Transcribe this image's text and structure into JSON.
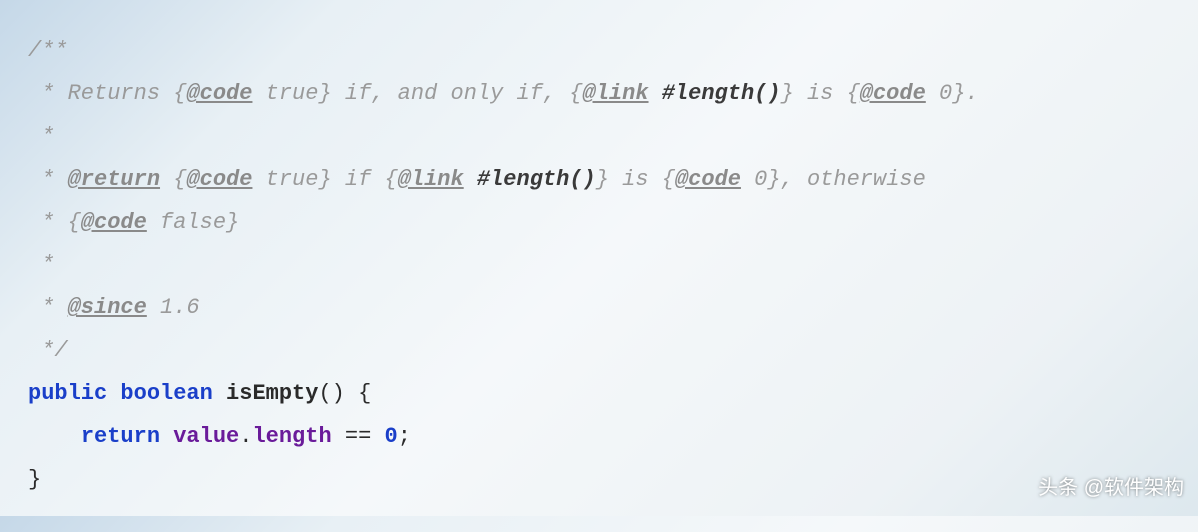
{
  "code": {
    "line1_open": "/**",
    "line2_prefix": " * Returns {",
    "line2_tag1": "@code",
    "line2_mid1": " true} if, and only if, {",
    "line2_tag2": "@link",
    "line2_mid2": " ",
    "line2_bold": "#length()",
    "line2_mid3": "} is {",
    "line2_tag3": "@code",
    "line2_end": " 0}.",
    "line3": " *",
    "line4_prefix": " * ",
    "line4_tag1": "@return",
    "line4_mid1": " {",
    "line4_tag2": "@code",
    "line4_mid2": " true} if {",
    "line4_tag3": "@link",
    "line4_mid3": " ",
    "line4_bold": "#length()",
    "line4_mid4": "} is {",
    "line4_tag4": "@code",
    "line4_end": " 0}, otherwise",
    "line5_prefix": " * {",
    "line5_tag": "@code",
    "line5_end": " false}",
    "line6": " *",
    "line7_prefix": " * ",
    "line7_tag": "@since",
    "line7_end": " 1.6",
    "line8": " */",
    "line9_kw1": "public",
    "line9_kw2": "boolean",
    "line9_name": "isEmpty",
    "line9_paren": "() ",
    "line9_brace": "{",
    "line10_indent": "    ",
    "line10_kw": "return",
    "line10_sp": " ",
    "line10_var": "value",
    "line10_dot": ".",
    "line10_field": "length",
    "line10_op": " == ",
    "line10_num": "0",
    "line10_semi": ";",
    "line11": "}"
  },
  "watermark": "头条 @软件架构"
}
